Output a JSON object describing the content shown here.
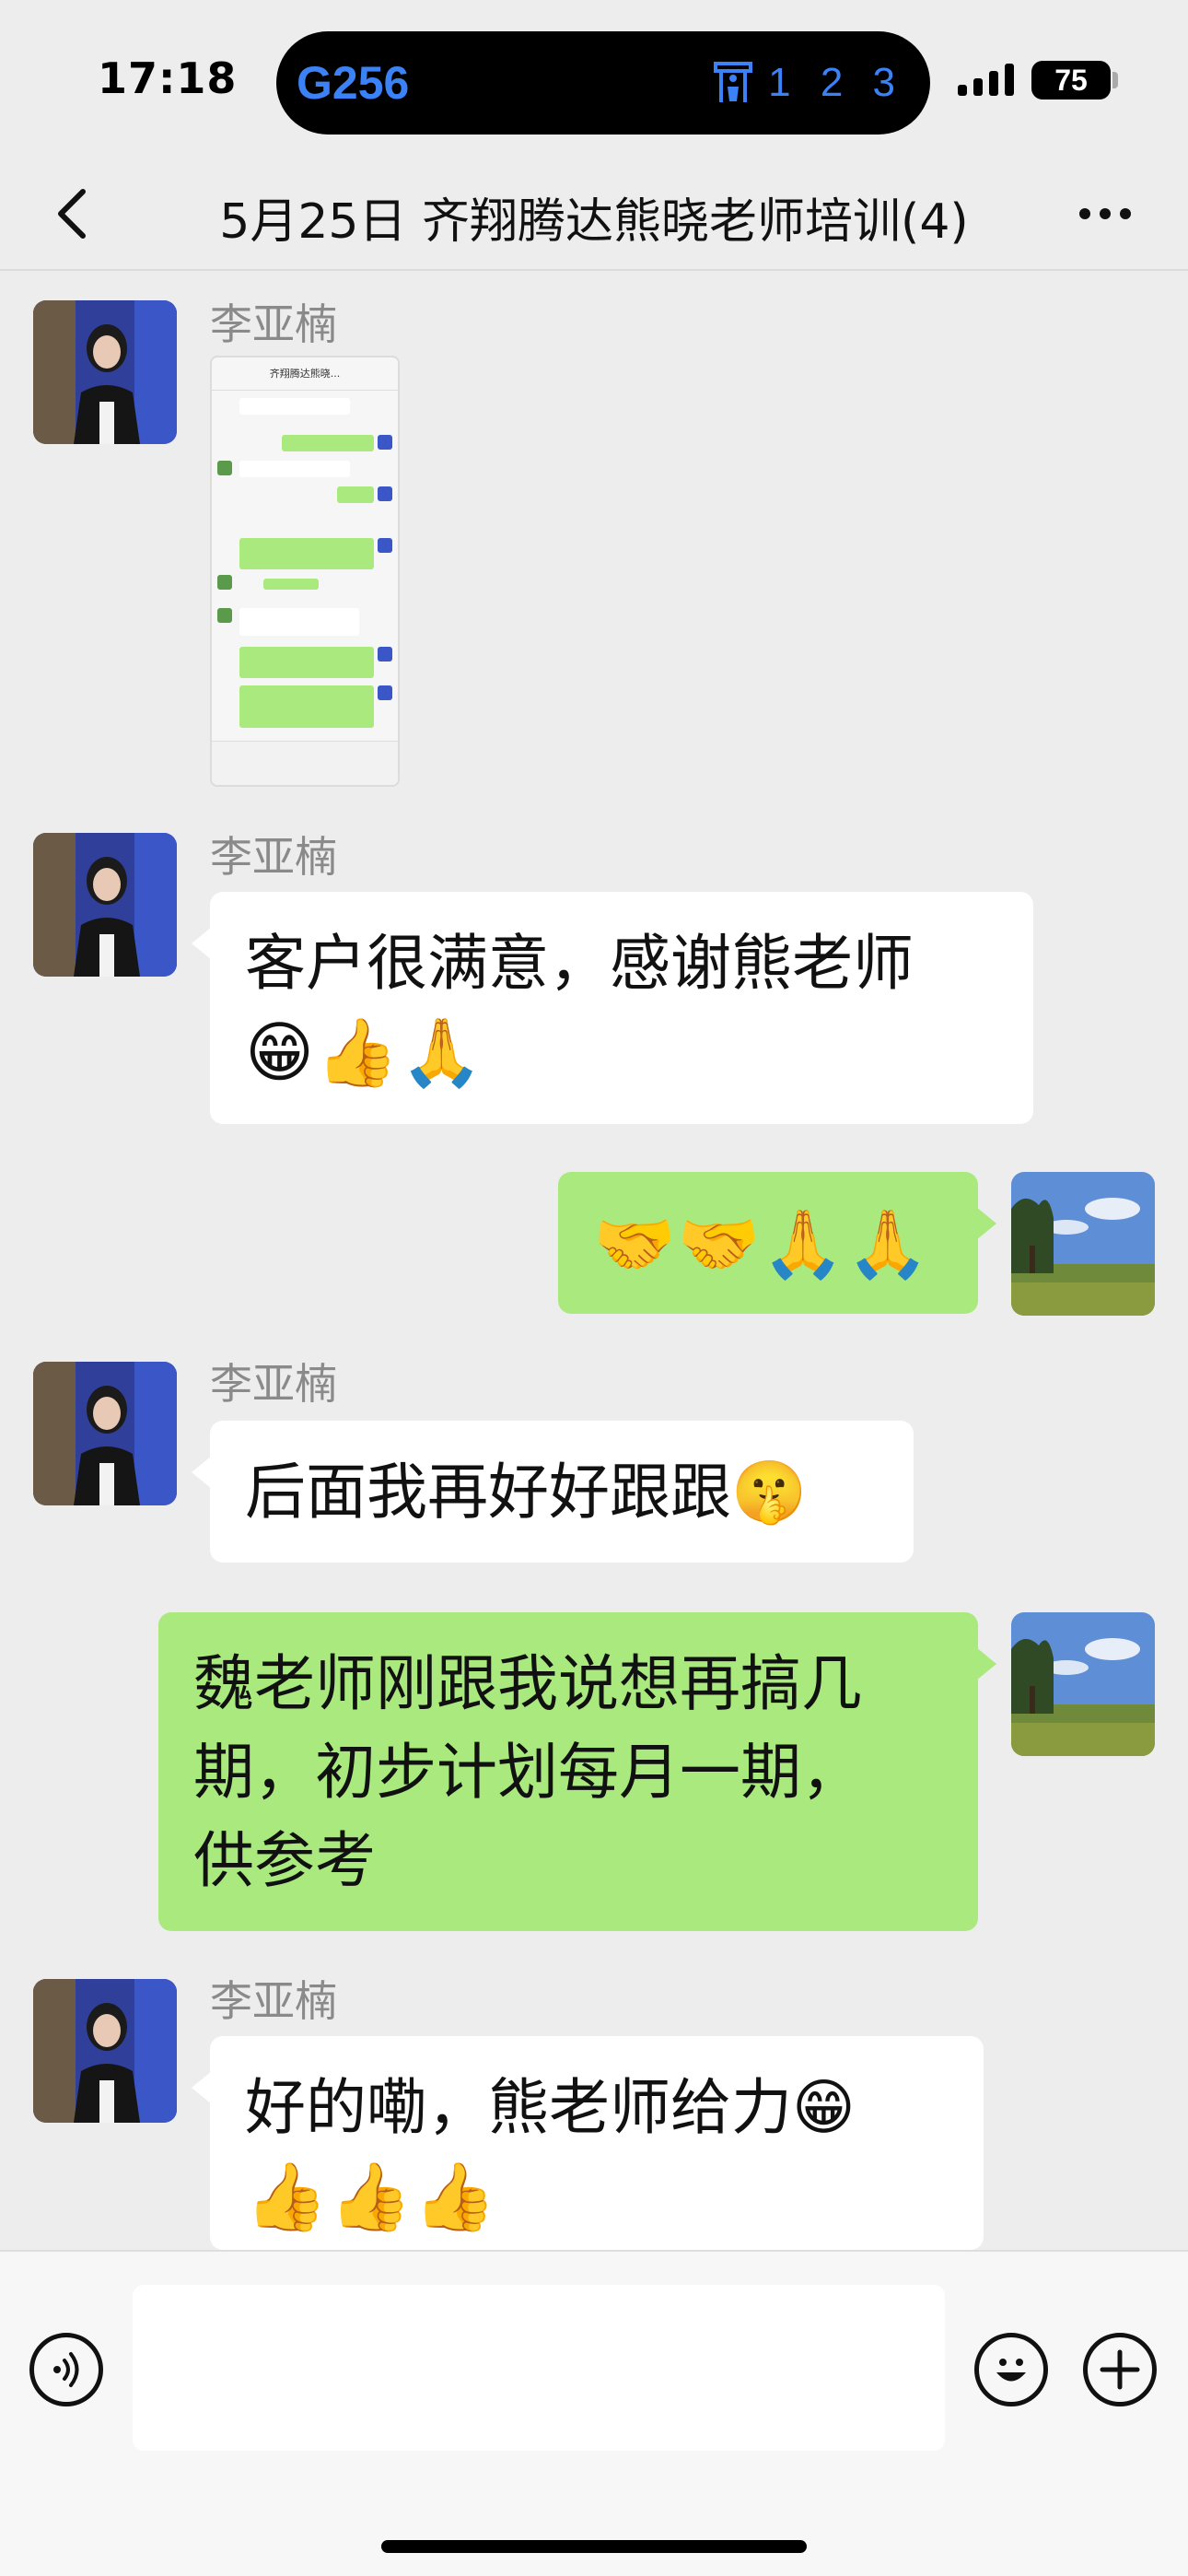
{
  "status_bar": {
    "time": "17:18",
    "island_left": "G256",
    "island_right": "1 2 3",
    "battery": "75"
  },
  "nav": {
    "title": "5月25日 齐翔腾达熊晓老师培训(4)",
    "back_icon": "chevron-left-icon",
    "more_icon": "more-dots-icon"
  },
  "messages": [
    {
      "sender": "李亚楠",
      "type": "image",
      "direction": "in",
      "thumb_title": "齐翔腾达熊晓..."
    },
    {
      "sender": "李亚楠",
      "type": "text",
      "direction": "in",
      "line1": "客户很满意，感谢熊老师",
      "line2": "😁👍🙏"
    },
    {
      "sender": "",
      "type": "text",
      "direction": "out",
      "line1": "🤝🤝🙏🙏"
    },
    {
      "sender": "李亚楠",
      "type": "text",
      "direction": "in",
      "line1": "后面我再好好跟跟🤫"
    },
    {
      "sender": "",
      "type": "text",
      "direction": "out",
      "line1": "魏老师刚跟我说想再搞几",
      "line2": "期，初步计划每月一期，",
      "line3": "供参考"
    },
    {
      "sender": "李亚楠",
      "type": "text",
      "direction": "in",
      "line1": "好的嘞，熊老师给力😁",
      "line2": "👍👍👍"
    }
  ],
  "input_bar": {
    "voice_icon": "voice-icon",
    "emoji_icon": "emoji-icon",
    "plus_icon": "plus-icon",
    "placeholder": ""
  },
  "colors": {
    "background": "#ededed",
    "outgoing_bubble": "#a9e97e",
    "incoming_bubble": "#ffffff",
    "island_text": "#3b82f6"
  }
}
